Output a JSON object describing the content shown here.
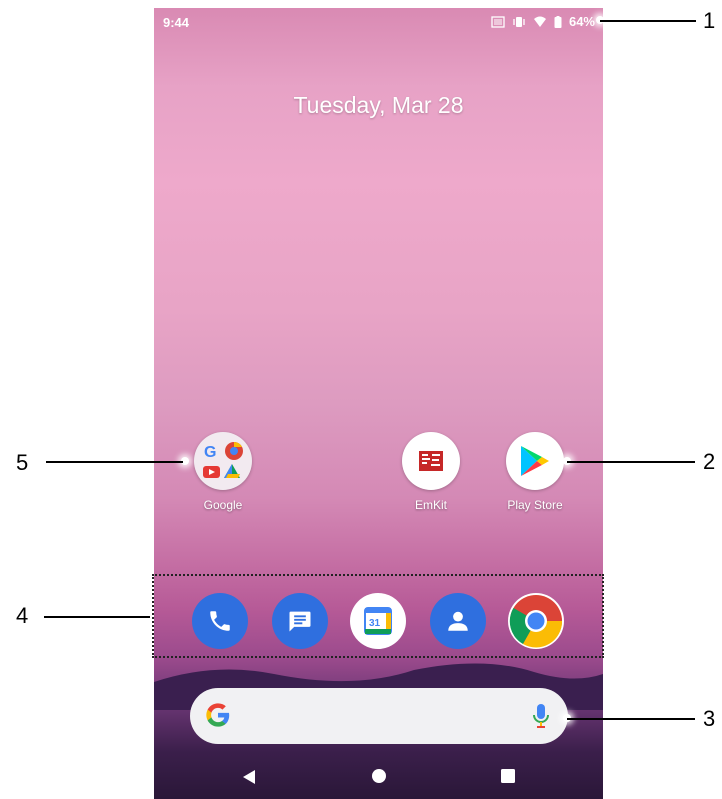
{
  "status_bar": {
    "time": "9:44",
    "battery": "64%"
  },
  "date": "Tuesday, Mar 28",
  "apps": [
    {
      "label": "Google"
    },
    {
      "label": "EmKit"
    },
    {
      "label": "Play Store"
    }
  ],
  "dock": [
    "phone-icon",
    "messages-icon",
    "calendar-icon",
    "contacts-icon",
    "chrome-icon"
  ],
  "calendar_day": "31",
  "callouts": [
    "1",
    "2",
    "3",
    "4",
    "5"
  ],
  "colors": {
    "phone": "#2f6fdf",
    "messages": "#2f6fdf",
    "contacts": "#2f6fdf"
  }
}
